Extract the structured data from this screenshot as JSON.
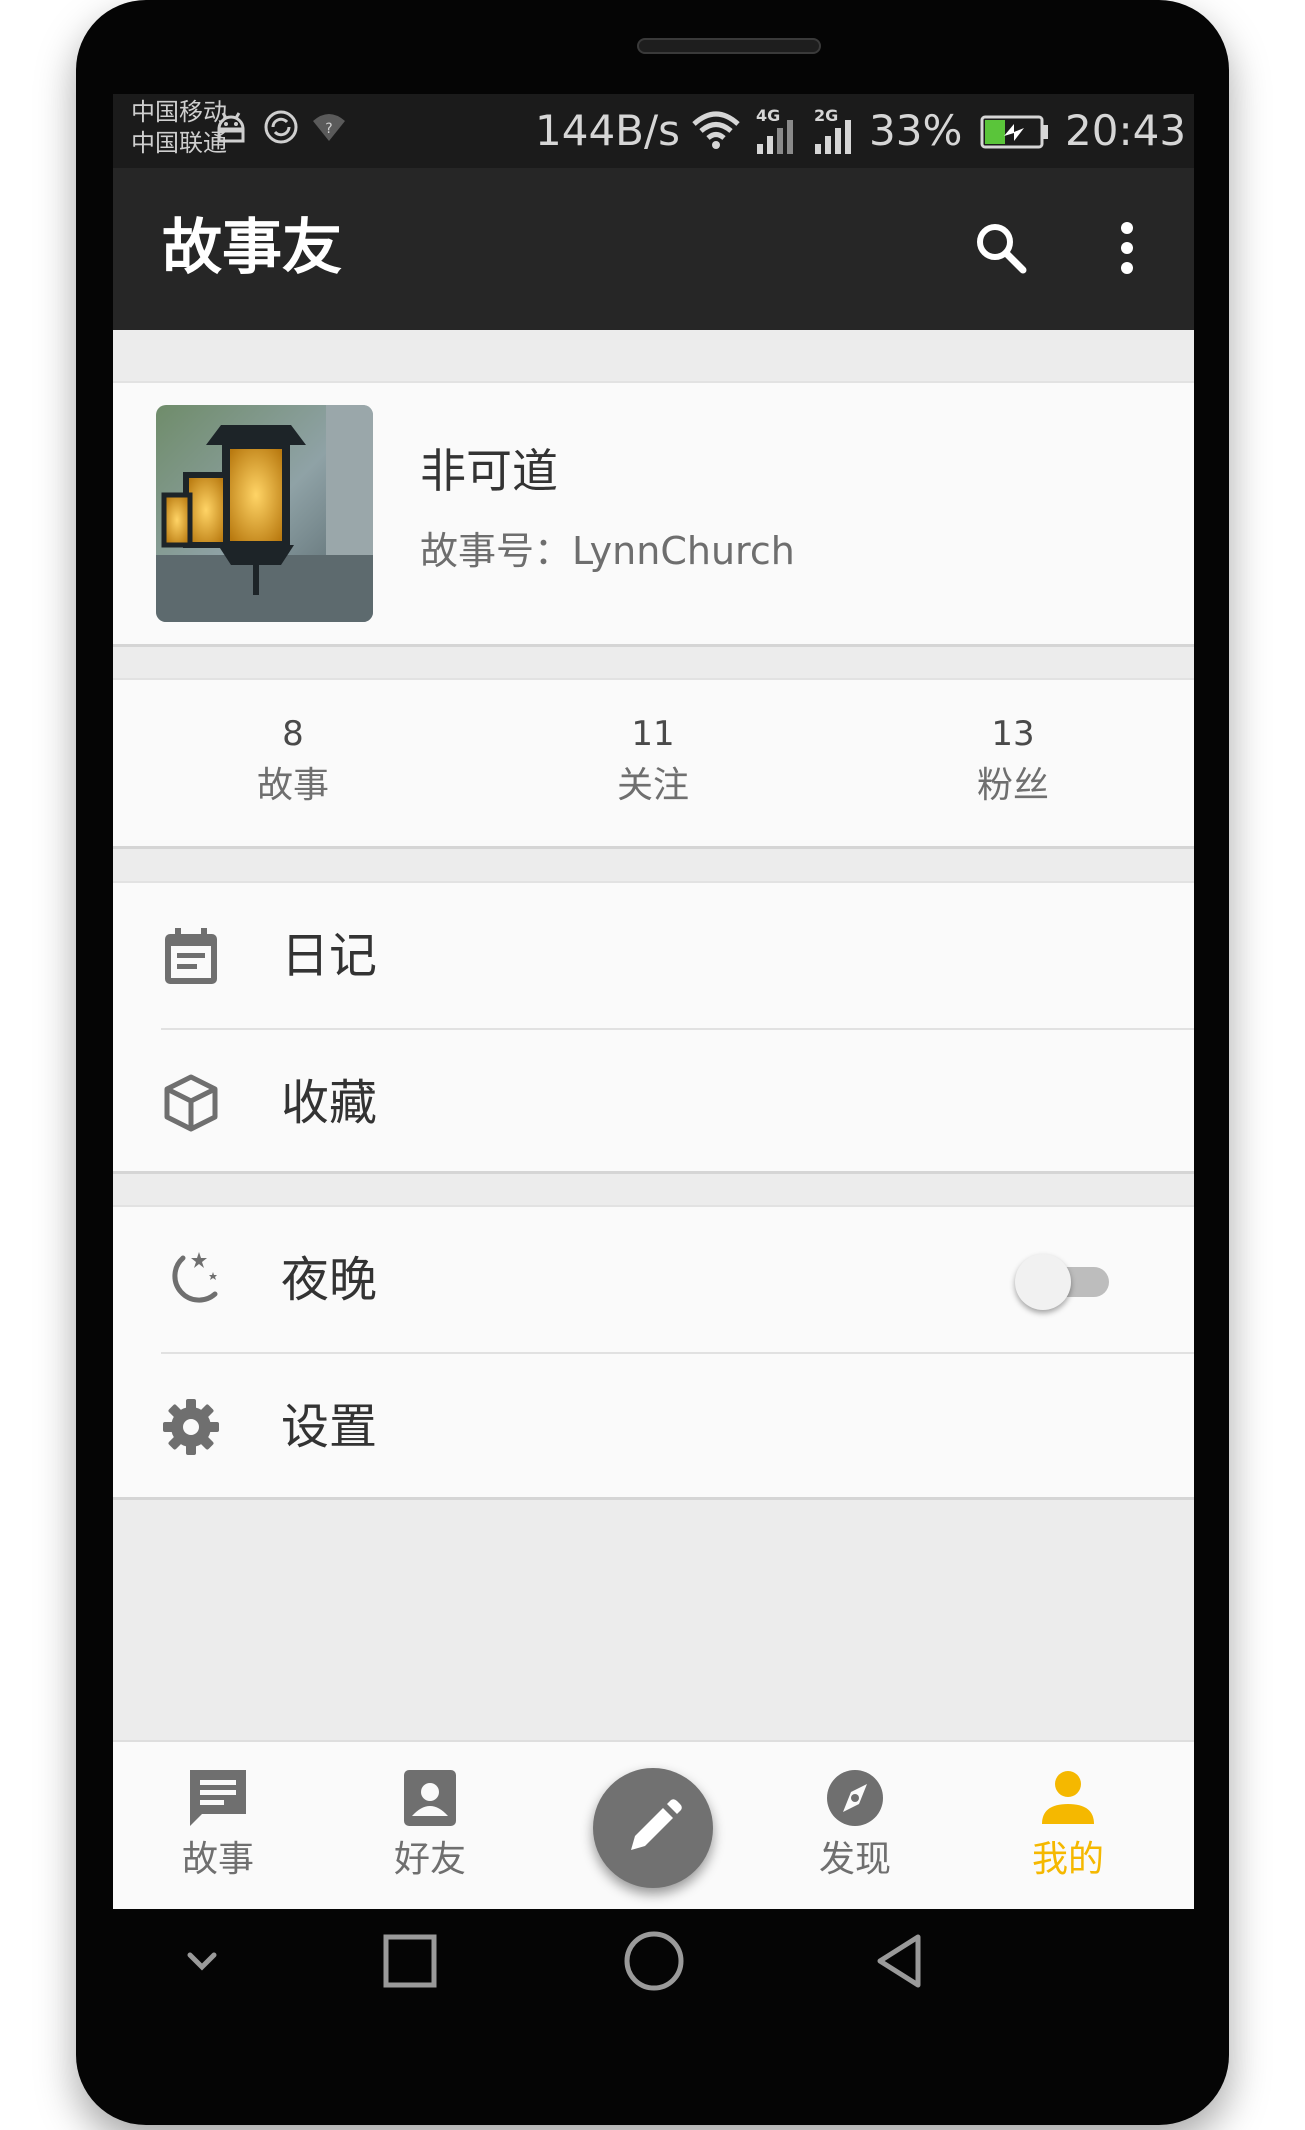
{
  "status_bar": {
    "carrier_1": "中国移动",
    "carrier_2": "中国联通",
    "net_speed": "144B/s",
    "sim1_tag": "4G",
    "sim2_tag": "2G",
    "battery": "33%",
    "time": "20:43",
    "icons": [
      "android-icon",
      "sync-icon",
      "wifi-question-icon",
      "wifi-icon",
      "signal-icon",
      "battery-charging-icon"
    ]
  },
  "app_bar": {
    "title": "故事友",
    "icons": [
      "search-icon",
      "more-vert-icon"
    ]
  },
  "profile": {
    "nickname": "非可道",
    "story_id": "故事号：LynnChurch",
    "avatar_icon": "lantern-photo"
  },
  "stats": [
    {
      "count": "8",
      "label": "故事"
    },
    {
      "count": "11",
      "label": "关注"
    },
    {
      "count": "13",
      "label": "粉丝"
    }
  ],
  "menu_group_1": [
    {
      "label": "日记",
      "icon": "calendar-icon"
    },
    {
      "label": "收藏",
      "icon": "cube-icon"
    }
  ],
  "menu_group_2": [
    {
      "label": "夜晚",
      "icon": "night-moon-icon",
      "toggle_on": false
    },
    {
      "label": "设置",
      "icon": "gear-icon"
    }
  ],
  "bottom_nav": {
    "tabs": [
      {
        "label": "故事",
        "icon": "chat-icon",
        "active": false
      },
      {
        "label": "好友",
        "icon": "contact-icon",
        "active": false
      },
      {
        "label": "发现",
        "icon": "compass-icon",
        "active": false
      },
      {
        "label": "我的",
        "icon": "person-icon",
        "active": true
      }
    ],
    "fab_icon": "pencil-icon"
  },
  "system_nav": [
    "chevron-down-icon",
    "recents-square-icon",
    "home-circle-icon",
    "back-triangle-icon"
  ],
  "colors": {
    "app_bar": "#262626",
    "status_bar": "#1b1b1b",
    "accent_active": "#f5b800",
    "icon_gray": "#6f6f6f",
    "fab": "#717171"
  }
}
